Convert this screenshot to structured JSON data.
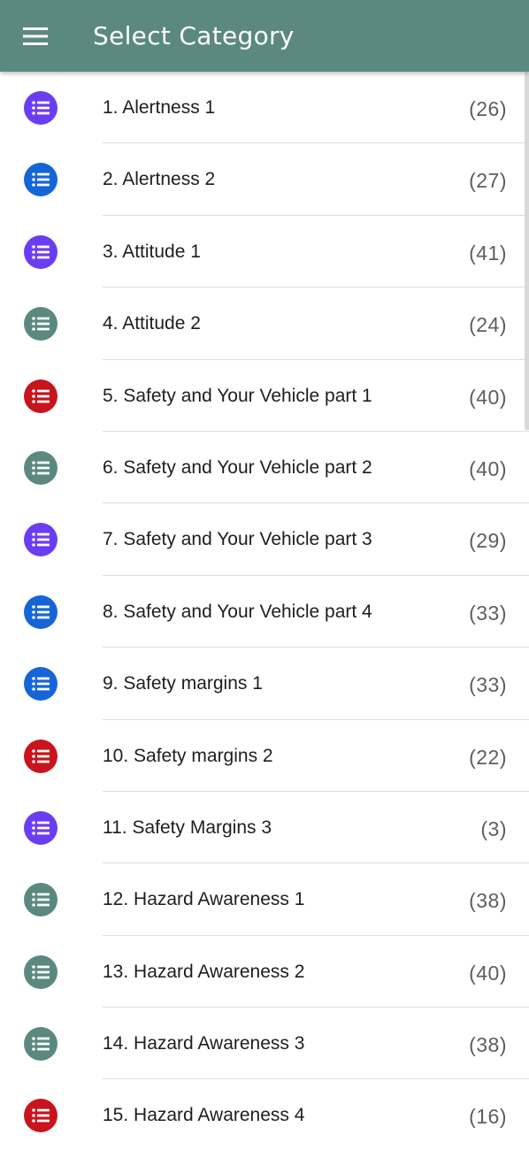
{
  "app_bar": {
    "title": "Select Category",
    "menu_icon": "hamburger-menu-icon",
    "color": "#5b887f"
  },
  "categories": [
    {
      "label": "1. Alertness 1",
      "count": "(26)",
      "icon": "list-icon",
      "color": "#6a3df2"
    },
    {
      "label": "2. Alertness 2",
      "count": "(27)",
      "icon": "list-icon",
      "color": "#1565d8"
    },
    {
      "label": "3. Attitude 1",
      "count": "(41)",
      "icon": "list-icon",
      "color": "#6a3df2"
    },
    {
      "label": "4. Attitude 2",
      "count": "(24)",
      "icon": "list-icon",
      "color": "#5b887f"
    },
    {
      "label": "5. Safety and Your Vehicle part 1",
      "count": "(40)",
      "icon": "list-icon",
      "color": "#c8141d"
    },
    {
      "label": "6. Safety and Your Vehicle part 2",
      "count": "(40)",
      "icon": "list-icon",
      "color": "#5b887f"
    },
    {
      "label": "7. Safety and Your Vehicle part 3",
      "count": "(29)",
      "icon": "list-icon",
      "color": "#6a3df2"
    },
    {
      "label": "8. Safety and Your Vehicle part 4",
      "count": "(33)",
      "icon": "list-icon",
      "color": "#1565d8"
    },
    {
      "label": "9. Safety margins 1",
      "count": "(33)",
      "icon": "list-icon",
      "color": "#1565d8"
    },
    {
      "label": "10. Safety margins 2",
      "count": "(22)",
      "icon": "list-icon",
      "color": "#c8141d"
    },
    {
      "label": "11. Safety Margins 3",
      "count": "(3)",
      "icon": "list-icon",
      "color": "#6a3df2"
    },
    {
      "label": "12. Hazard Awareness 1",
      "count": "(38)",
      "icon": "list-icon",
      "color": "#5b887f"
    },
    {
      "label": "13. Hazard Awareness 2",
      "count": "(40)",
      "icon": "list-icon",
      "color": "#5b887f"
    },
    {
      "label": "14. Hazard Awareness 3",
      "count": "(38)",
      "icon": "list-icon",
      "color": "#5b887f"
    },
    {
      "label": "15. Hazard Awareness 4",
      "count": "(16)",
      "icon": "list-icon",
      "color": "#c8141d"
    }
  ]
}
